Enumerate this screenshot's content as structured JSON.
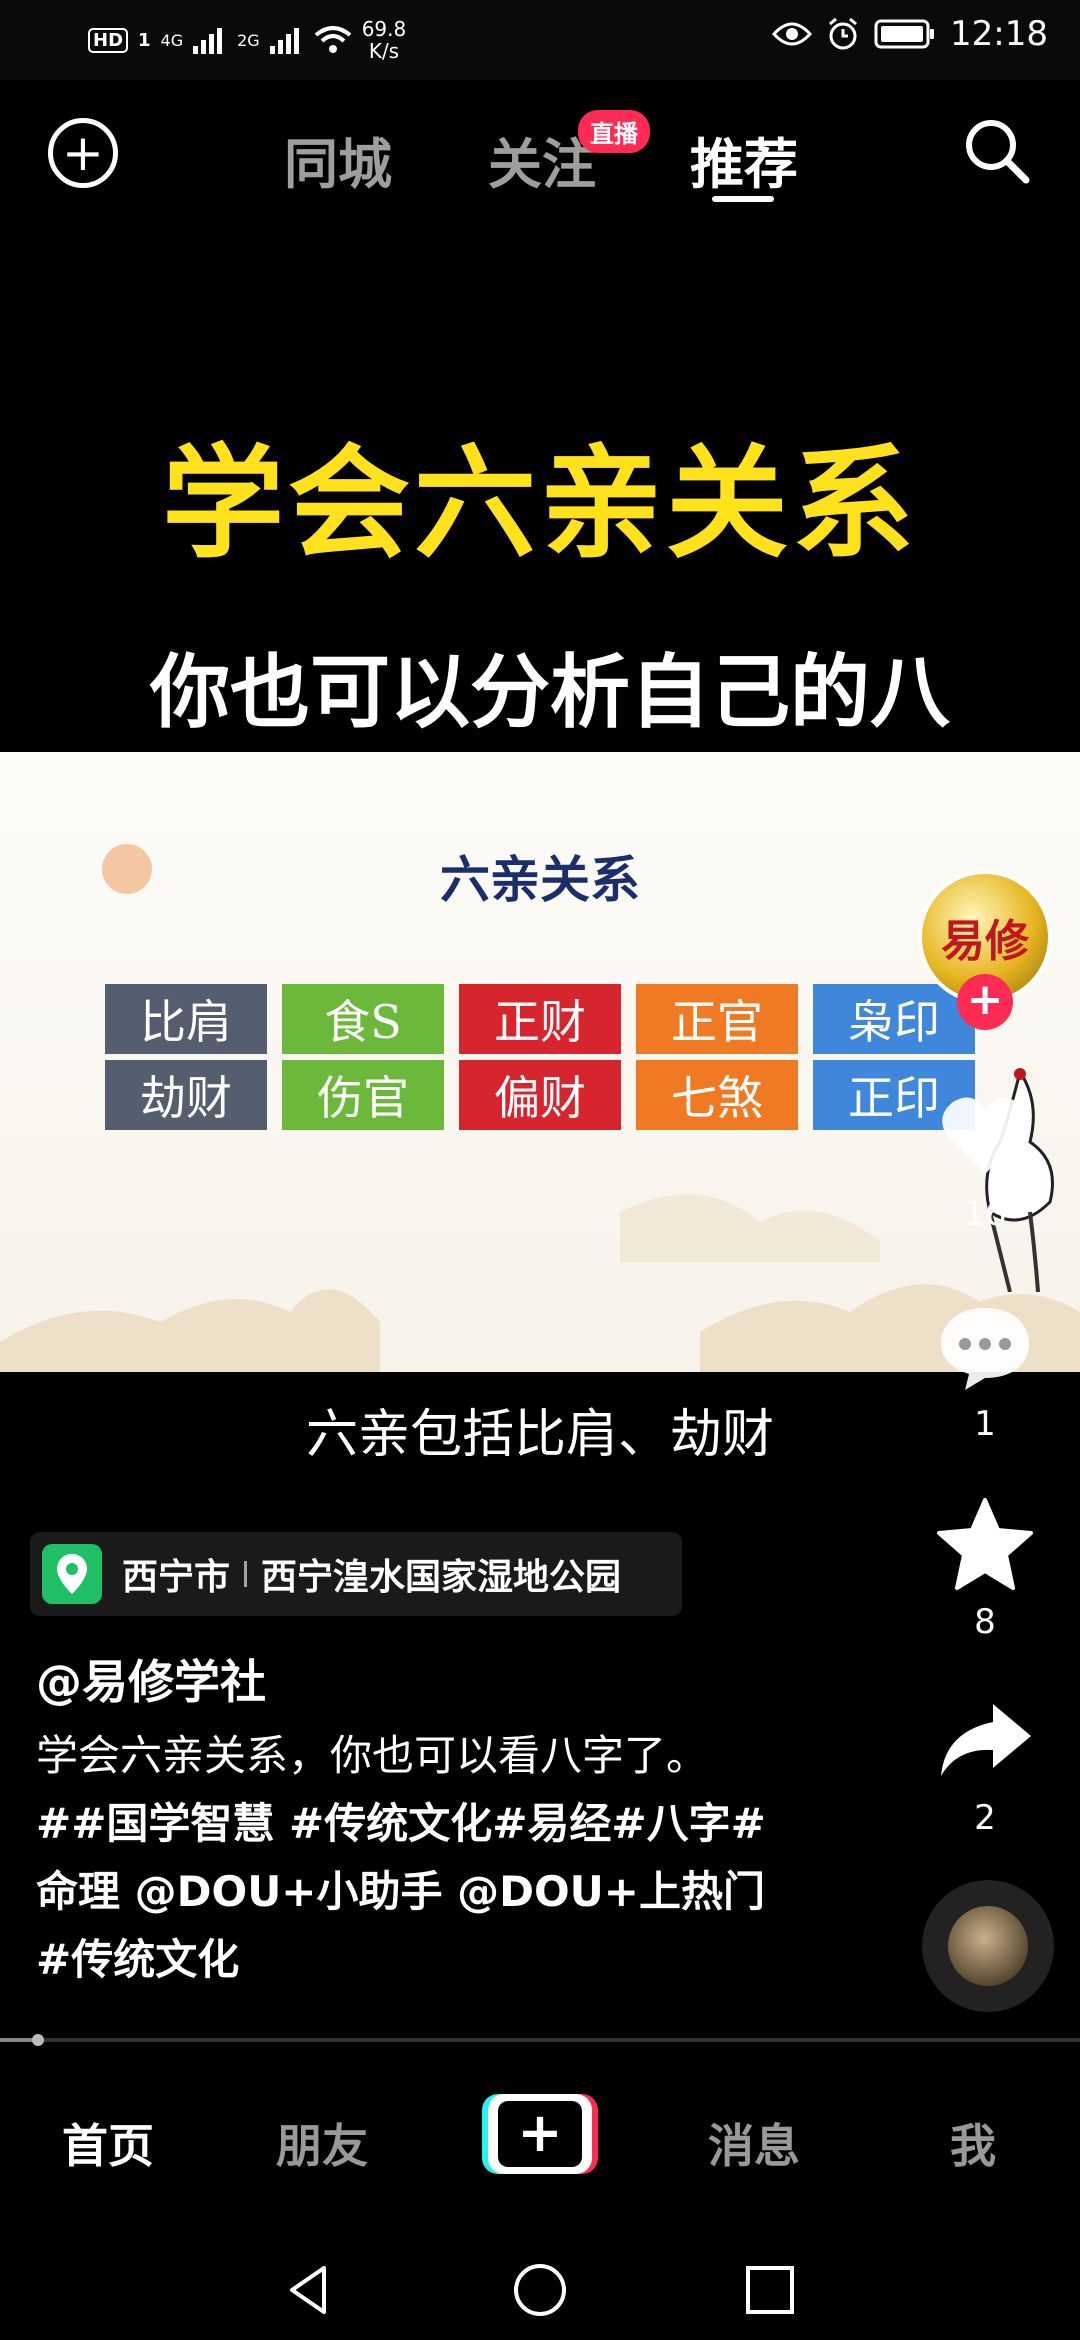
{
  "status_bar": {
    "hd": "HD",
    "sim1": "1",
    "net1": "4G",
    "net2": "2G",
    "speed_value": "69.8",
    "speed_unit": "K/s",
    "time": "12:18",
    "icons": [
      "eye-icon",
      "alarm-icon",
      "battery-icon"
    ]
  },
  "top_nav": {
    "tabs": [
      {
        "label": "同城",
        "active": false
      },
      {
        "label": "关注",
        "active": false
      },
      {
        "label": "推荐",
        "active": true
      }
    ],
    "live_badge": "直播"
  },
  "video": {
    "headline": "学会六亲关系",
    "subheadline": "你也可以分析自己的八字",
    "slide_title": "六亲关系",
    "grid_rows": [
      [
        "比肩",
        "食S",
        "正财",
        "正官",
        "枭印"
      ],
      [
        "劫财",
        "伤官",
        "偏财",
        "七煞",
        "正印"
      ]
    ],
    "caption": "六亲包括比肩、劫财",
    "colors": {
      "headline": "#ffe21c",
      "slide_title": "#1b2e6b",
      "gray": "#545e6e",
      "green": "#6cb83a",
      "red": "#d6252c",
      "orange": "#ef7a23",
      "blue": "#3f87da"
    }
  },
  "side_rail": {
    "avatar_text": "易修",
    "like_count": "16",
    "comment_count": "1",
    "favorite_count": "8",
    "share_count": "2"
  },
  "post": {
    "location_city": "西宁市",
    "location_place": "西宁湟水国家湿地公园",
    "author": "@易修学社",
    "description_line1": "学会六亲关系，你也可以看八字了。",
    "tags_line1": "##国学智慧 #传统文化#易经#八字#",
    "tags_line2": "命理 @DOU+小助手 @DOU+上热门",
    "tags_line3": "#传统文化"
  },
  "bottom_nav": {
    "home": "首页",
    "friends": "朋友",
    "create": "+",
    "messages": "消息",
    "me": "我"
  }
}
